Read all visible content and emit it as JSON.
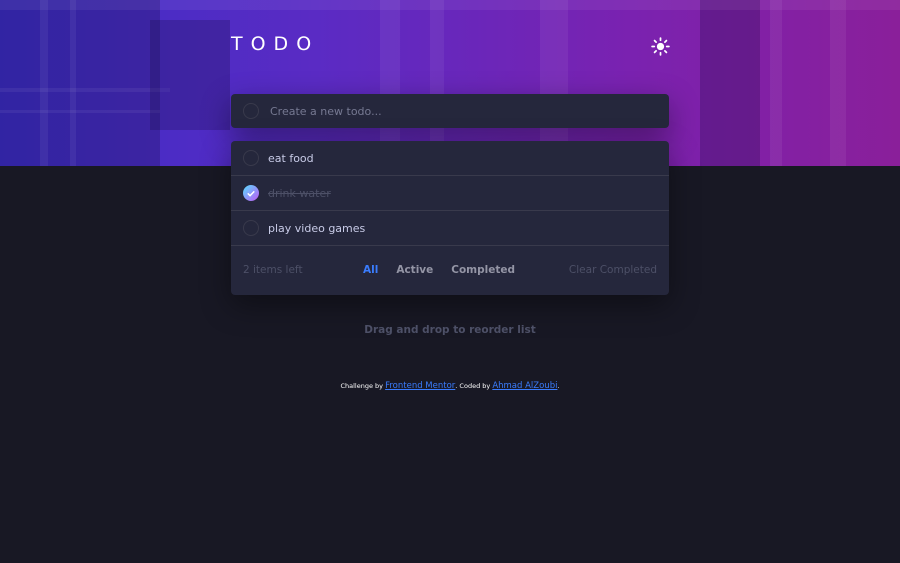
{
  "header": {
    "title": "TODO",
    "theme_icon": "sun-icon"
  },
  "new_todo": {
    "placeholder": "Create a new todo..."
  },
  "todos": [
    {
      "text": "eat food",
      "completed": false
    },
    {
      "text": "drink water",
      "completed": true
    },
    {
      "text": "play video games",
      "completed": false
    }
  ],
  "footer": {
    "items_left": "2 items left",
    "filter_all": "All",
    "filter_active": "Active",
    "filter_completed": "Completed",
    "clear_completed": "Clear Completed",
    "active_filter": "All"
  },
  "hint": "Drag and drop to reorder list",
  "attribution": {
    "challenge_prefix": "Challenge by",
    "challenge_link": "Frontend Mentor",
    "coded_prefix": ". Coded by",
    "coder_link": "Ahmad AlZoubi",
    "suffix": "."
  },
  "colors": {
    "background": "#181824",
    "card": "#25273c",
    "accent": "#3a7cfd",
    "check_gradient_start": "#57ddff",
    "check_gradient_end": "#c058f3"
  }
}
